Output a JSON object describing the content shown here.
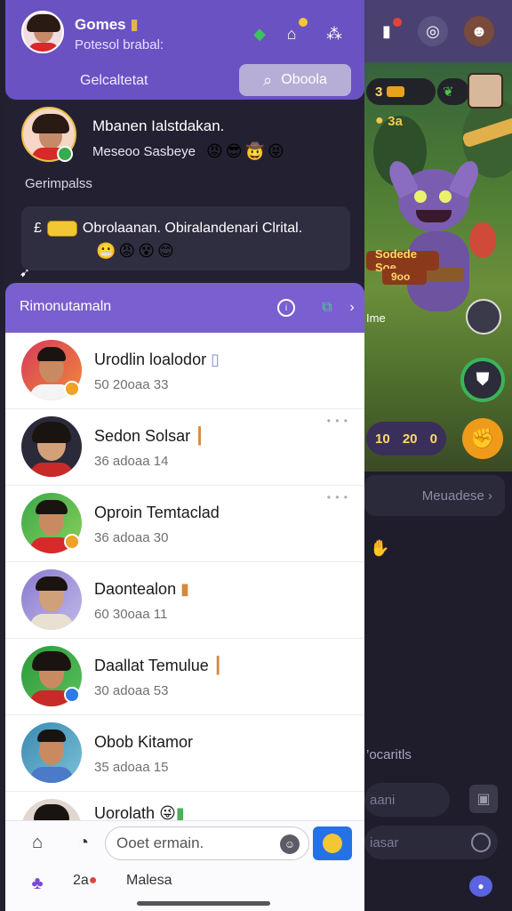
{
  "header": {
    "title": "Gomes",
    "subtitle": "Potesol brabal:",
    "left_label": "Gelcaltetat",
    "search_label": "Oboola"
  },
  "feature": {
    "title": "Mbanen Ialstdakan.",
    "subtitle": "Meseoo Sasbeye"
  },
  "section_label": "Gerimpalss",
  "notice": {
    "prefix": "£",
    "text": "Obrolaanan. Obiralandenari Clrital."
  },
  "list_header": {
    "title": "Rimonutamaln"
  },
  "contacts": [
    {
      "name": "Urodlin loalodor",
      "meta": "50 20oaa 33",
      "badge_color": "#f0a12a",
      "tag": "▯"
    },
    {
      "name": "Sedon Solsar",
      "meta": "36 adoaa 14",
      "badge_color": "",
      "tag": "┃"
    },
    {
      "name": "Oproin Temtaclad",
      "meta": "36 adoaa 30",
      "badge_color": "#f0a12a",
      "tag": ""
    },
    {
      "name": "Daontealon",
      "meta": "60 30oaa 11",
      "badge_color": "",
      "tag": "▮"
    },
    {
      "name": "Daallat Temulue",
      "meta": "30 adoaa 53",
      "badge_color": "#2b7be8",
      "tag": "┃"
    },
    {
      "name": "Obob Kitamor",
      "meta": "35 adoaa 15",
      "badge_color": "",
      "tag": ""
    },
    {
      "name": "Uorolath",
      "meta": "",
      "badge_color": "",
      "tag": ""
    }
  ],
  "composer": {
    "placeholder": "Ooet ermain.",
    "count": "2a",
    "label": "Malesa"
  },
  "game": {
    "hud_left": "3",
    "hud_mid": "3a",
    "banner": "Sodede Soe",
    "banner2": "9oo",
    "tag": "Ime",
    "score_left": "10",
    "score_right": "20",
    "score_end": "0",
    "msg_bar": "Meuadese",
    "side_text": "’ocaritls",
    "input1": "aani",
    "input2": "iasar"
  },
  "colors": {
    "header_bg": "#6a52c2",
    "list_header_bg": "#7a5fd0",
    "send_button": "#2472e6"
  }
}
